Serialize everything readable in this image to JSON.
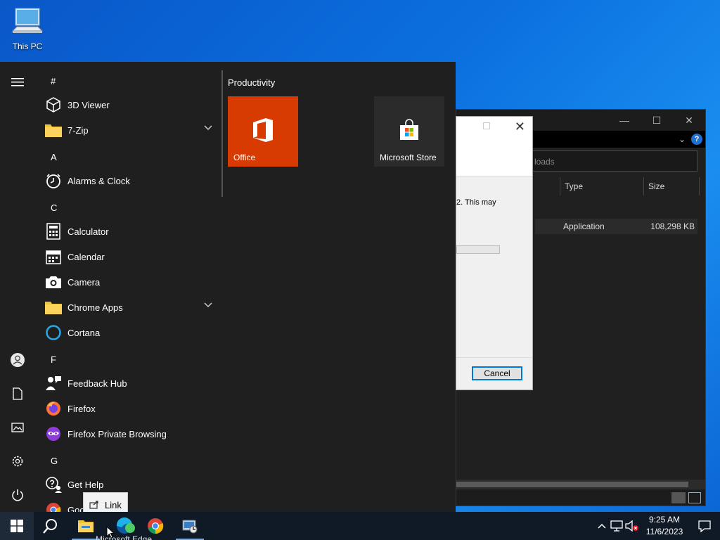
{
  "desktop": {
    "this_pc_label": "This PC"
  },
  "explorer": {
    "address_text": "loads",
    "columns": [
      "Type",
      "Size"
    ],
    "row": {
      "type": "Application",
      "size": "108,298 KB"
    },
    "help_label": "?"
  },
  "dialog": {
    "message": "2. This may",
    "cancel_label": "Cancel"
  },
  "start_menu": {
    "letters": {
      "hash": "#",
      "a": "A",
      "c": "C",
      "f": "F",
      "g": "G"
    },
    "apps": {
      "viewer": "3D Viewer",
      "zip": "7-Zip",
      "alarms": "Alarms & Clock",
      "calculator": "Calculator",
      "calendar": "Calendar",
      "camera": "Camera",
      "chrome_apps": "Chrome Apps",
      "cortana": "Cortana",
      "feedback": "Feedback Hub",
      "firefox": "Firefox",
      "firefox_private": "Firefox Private Browsing",
      "get_help": "Get Help",
      "google": "Goo"
    },
    "tiles_group": "Productivity",
    "tiles": {
      "office": "Office",
      "store": "Microsoft Store"
    }
  },
  "tooltip": {
    "label": "Link"
  },
  "taskbar": {
    "edge_ghost_label": "Microsoft Edge",
    "time": "9:25 AM",
    "date": "11/6/2023"
  },
  "colors": {
    "office_tile": "#d83b01",
    "store_tile": "#2b2b2b",
    "start_bg": "#1f1f1f",
    "taskbar_bg": "#0f1a26",
    "accent": "#0078d7"
  }
}
